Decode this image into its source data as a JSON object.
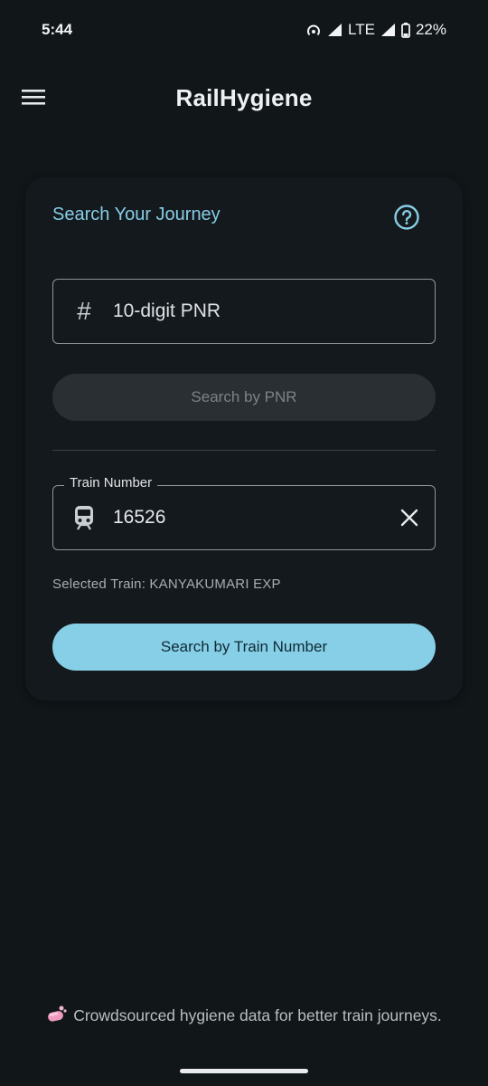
{
  "status_bar": {
    "time": "5:44",
    "network": "LTE",
    "battery": "22%"
  },
  "app_bar": {
    "title": "RailHygiene",
    "menu_icon": "hamburger-menu-icon"
  },
  "card": {
    "title": "Search Your Journey",
    "help_icon": "help-circle-icon",
    "pnr": {
      "icon": "hash-icon",
      "value": "",
      "placeholder": "10-digit PNR"
    },
    "pnr_button_label": "Search by PNR",
    "train": {
      "label": "Train Number",
      "icon": "train-icon",
      "value": "16526",
      "clear_icon": "close-icon"
    },
    "selected_train": "Selected Train: KANYAKUMARI EXP",
    "train_button_label": "Search by Train Number"
  },
  "footer": {
    "icon": "soap-icon",
    "text": "Crowdsourced hygiene data for better train journeys."
  },
  "colors": {
    "background": "#111619",
    "accent": "#86cfe6",
    "card": "#14191d"
  }
}
